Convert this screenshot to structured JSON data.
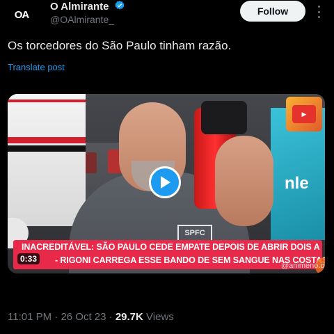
{
  "author": {
    "name": "O Almirante",
    "handle": "@OAlmirante_",
    "avatar_text": "OA",
    "verified": true
  },
  "follow_label": "Follow",
  "tweet": {
    "text": "Os torcedores do São Paulo tinham razão.",
    "translate_label": "Translate post"
  },
  "video": {
    "duration": "0:33",
    "headline_line1": "INACREDITÁVEL: SÃO PAULO CEDE EMPATE DEPOIS DE ABRIR DOIS A",
    "headline_line2": "- RIGONI CARREGA ESSE BANDO DE SEM SANGUE NAS COSTAS!",
    "watermark": "@animeno.o",
    "shirt_text": "SPFC",
    "jersey_text": "nle"
  },
  "meta": {
    "time": "11:01 PM",
    "separator": "·",
    "date": "26 Oct 23",
    "views_count": "29.7K",
    "views_label": "Views"
  },
  "colors": {
    "background": "#000000",
    "accent": "#1d9bf0",
    "headline_bar": "#e8294a",
    "follow_button": "#eff3f4"
  },
  "icons": {
    "verified": "verified-badge-icon",
    "more": "more-options-icon",
    "play": "play-icon"
  }
}
